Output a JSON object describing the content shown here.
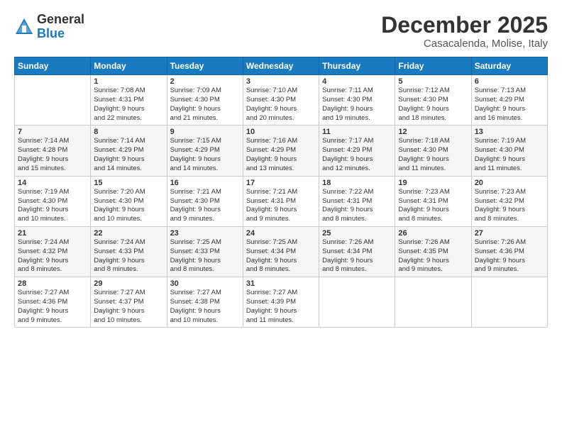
{
  "logo": {
    "general": "General",
    "blue": "Blue"
  },
  "title": "December 2025",
  "location": "Casacalenda, Molise, Italy",
  "days_of_week": [
    "Sunday",
    "Monday",
    "Tuesday",
    "Wednesday",
    "Thursday",
    "Friday",
    "Saturday"
  ],
  "weeks": [
    [
      {
        "day": "",
        "info": ""
      },
      {
        "day": "1",
        "info": "Sunrise: 7:08 AM\nSunset: 4:31 PM\nDaylight: 9 hours\nand 22 minutes."
      },
      {
        "day": "2",
        "info": "Sunrise: 7:09 AM\nSunset: 4:30 PM\nDaylight: 9 hours\nand 21 minutes."
      },
      {
        "day": "3",
        "info": "Sunrise: 7:10 AM\nSunset: 4:30 PM\nDaylight: 9 hours\nand 20 minutes."
      },
      {
        "day": "4",
        "info": "Sunrise: 7:11 AM\nSunset: 4:30 PM\nDaylight: 9 hours\nand 19 minutes."
      },
      {
        "day": "5",
        "info": "Sunrise: 7:12 AM\nSunset: 4:30 PM\nDaylight: 9 hours\nand 18 minutes."
      },
      {
        "day": "6",
        "info": "Sunrise: 7:13 AM\nSunset: 4:29 PM\nDaylight: 9 hours\nand 16 minutes."
      }
    ],
    [
      {
        "day": "7",
        "info": "Sunrise: 7:14 AM\nSunset: 4:28 PM\nDaylight: 9 hours\nand 15 minutes."
      },
      {
        "day": "8",
        "info": "Sunrise: 7:14 AM\nSunset: 4:29 PM\nDaylight: 9 hours\nand 14 minutes."
      },
      {
        "day": "9",
        "info": "Sunrise: 7:15 AM\nSunset: 4:29 PM\nDaylight: 9 hours\nand 14 minutes."
      },
      {
        "day": "10",
        "info": "Sunrise: 7:16 AM\nSunset: 4:29 PM\nDaylight: 9 hours\nand 13 minutes."
      },
      {
        "day": "11",
        "info": "Sunrise: 7:17 AM\nSunset: 4:29 PM\nDaylight: 9 hours\nand 12 minutes."
      },
      {
        "day": "12",
        "info": "Sunrise: 7:18 AM\nSunset: 4:30 PM\nDaylight: 9 hours\nand 11 minutes."
      },
      {
        "day": "13",
        "info": "Sunrise: 7:19 AM\nSunset: 4:30 PM\nDaylight: 9 hours\nand 11 minutes."
      }
    ],
    [
      {
        "day": "14",
        "info": "Sunrise: 7:19 AM\nSunset: 4:30 PM\nDaylight: 9 hours\nand 10 minutes."
      },
      {
        "day": "15",
        "info": "Sunrise: 7:20 AM\nSunset: 4:30 PM\nDaylight: 9 hours\nand 10 minutes."
      },
      {
        "day": "16",
        "info": "Sunrise: 7:21 AM\nSunset: 4:30 PM\nDaylight: 9 hours\nand 9 minutes."
      },
      {
        "day": "17",
        "info": "Sunrise: 7:21 AM\nSunset: 4:31 PM\nDaylight: 9 hours\nand 9 minutes."
      },
      {
        "day": "18",
        "info": "Sunrise: 7:22 AM\nSunset: 4:31 PM\nDaylight: 9 hours\nand 8 minutes."
      },
      {
        "day": "19",
        "info": "Sunrise: 7:23 AM\nSunset: 4:31 PM\nDaylight: 9 hours\nand 8 minutes."
      },
      {
        "day": "20",
        "info": "Sunrise: 7:23 AM\nSunset: 4:32 PM\nDaylight: 9 hours\nand 8 minutes."
      }
    ],
    [
      {
        "day": "21",
        "info": "Sunrise: 7:24 AM\nSunset: 4:32 PM\nDaylight: 9 hours\nand 8 minutes."
      },
      {
        "day": "22",
        "info": "Sunrise: 7:24 AM\nSunset: 4:33 PM\nDaylight: 9 hours\nand 8 minutes."
      },
      {
        "day": "23",
        "info": "Sunrise: 7:25 AM\nSunset: 4:33 PM\nDaylight: 9 hours\nand 8 minutes."
      },
      {
        "day": "24",
        "info": "Sunrise: 7:25 AM\nSunset: 4:34 PM\nDaylight: 9 hours\nand 8 minutes."
      },
      {
        "day": "25",
        "info": "Sunrise: 7:26 AM\nSunset: 4:34 PM\nDaylight: 9 hours\nand 8 minutes."
      },
      {
        "day": "26",
        "info": "Sunrise: 7:26 AM\nSunset: 4:35 PM\nDaylight: 9 hours\nand 9 minutes."
      },
      {
        "day": "27",
        "info": "Sunrise: 7:26 AM\nSunset: 4:36 PM\nDaylight: 9 hours\nand 9 minutes."
      }
    ],
    [
      {
        "day": "28",
        "info": "Sunrise: 7:27 AM\nSunset: 4:36 PM\nDaylight: 9 hours\nand 9 minutes."
      },
      {
        "day": "29",
        "info": "Sunrise: 7:27 AM\nSunset: 4:37 PM\nDaylight: 9 hours\nand 10 minutes."
      },
      {
        "day": "30",
        "info": "Sunrise: 7:27 AM\nSunset: 4:38 PM\nDaylight: 9 hours\nand 10 minutes."
      },
      {
        "day": "31",
        "info": "Sunrise: 7:27 AM\nSunset: 4:39 PM\nDaylight: 9 hours\nand 11 minutes."
      },
      {
        "day": "",
        "info": ""
      },
      {
        "day": "",
        "info": ""
      },
      {
        "day": "",
        "info": ""
      }
    ]
  ]
}
